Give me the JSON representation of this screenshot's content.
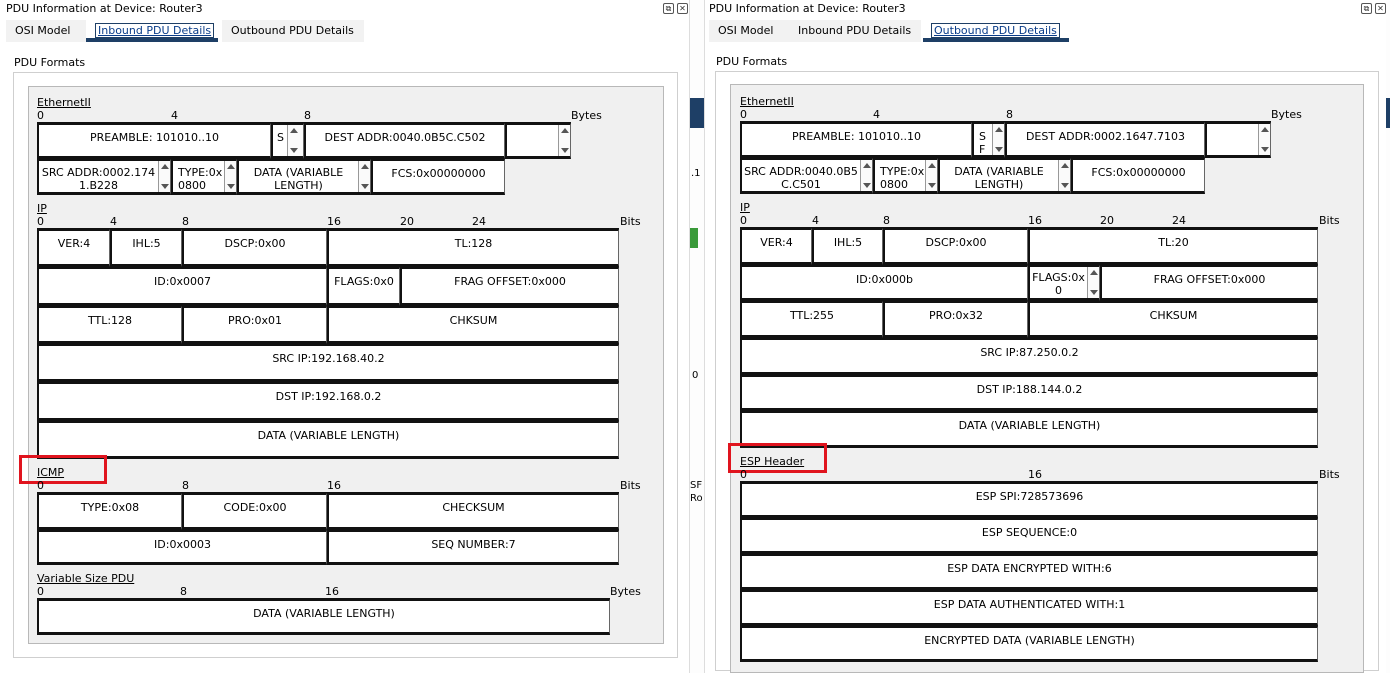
{
  "left": {
    "title": "PDU Information at Device: Router3",
    "tabs": [
      "OSI Model",
      "Inbound PDU Details",
      "Outbound PDU Details"
    ],
    "pdu_formats": "PDU Formats",
    "eth": {
      "name": "EthernetII",
      "ticks": [
        "0",
        "4",
        "8"
      ],
      "unit": "Bytes",
      "preamble": "PREAMBLE: 101010..10",
      "sfd": "S",
      "dest": "DEST ADDR:0040.0B5C.C502",
      "src": "SRC ADDR:0002.1741.B228",
      "type": "TYPE:0x0800",
      "data": "DATA (VARIABLE LENGTH)",
      "fcs": "FCS:0x00000000"
    },
    "ip": {
      "name": "IP",
      "ticks": [
        "0",
        "4",
        "8",
        "16",
        "20",
        "24"
      ],
      "unit": "Bits",
      "ver": "VER:4",
      "ihl": "IHL:5",
      "dscp": "DSCP:0x00",
      "tl": "TL:128",
      "id": "ID:0x0007",
      "flags": "FLAGS:0x0",
      "frag": "FRAG OFFSET:0x000",
      "ttl": "TTL:128",
      "pro": "PRO:0x01",
      "chksum": "CHKSUM",
      "src": "SRC IP:192.168.40.2",
      "dst": "DST IP:192.168.0.2",
      "data": "DATA (VARIABLE LENGTH)"
    },
    "icmp": {
      "name": "ICMP",
      "ticks": [
        "0",
        "8",
        "16"
      ],
      "unit": "Bits",
      "type": "TYPE:0x08",
      "code": "CODE:0x00",
      "checksum": "CHECKSUM",
      "id": "ID:0x0003",
      "seq": "SEQ NUMBER:7"
    },
    "var": {
      "name": "Variable Size PDU",
      "ticks": [
        "0",
        "8",
        "16"
      ],
      "unit": "Bytes",
      "data": "DATA (VARIABLE LENGTH)"
    }
  },
  "right": {
    "title": "PDU Information at Device: Router3",
    "tabs": [
      "OSI Model",
      "Inbound PDU Details",
      "Outbound PDU Details"
    ],
    "pdu_formats": "PDU Formats",
    "eth": {
      "name": "EthernetII",
      "ticks": [
        "0",
        "4",
        "8"
      ],
      "unit": "Bytes",
      "preamble": "PREAMBLE: 101010..10",
      "sfd": "SF",
      "dest": "DEST ADDR:0002.1647.7103",
      "src": "SRC ADDR:0040.0B5C.C501",
      "type": "TYPE:0x0800",
      "data": "DATA (VARIABLE LENGTH)",
      "fcs": "FCS:0x00000000"
    },
    "ip": {
      "name": "IP",
      "ticks": [
        "0",
        "4",
        "8",
        "16",
        "20",
        "24"
      ],
      "unit": "Bits",
      "ver": "VER:4",
      "ihl": "IHL:5",
      "dscp": "DSCP:0x00",
      "tl": "TL:20",
      "id": "ID:0x000b",
      "flags": "FLAGS:0x0",
      "frag": "FRAG OFFSET:0x000",
      "ttl": "TTL:255",
      "pro": "PRO:0x32",
      "chksum": "CHKSUM",
      "src": "SRC IP:87.250.0.2",
      "dst": "DST IP:188.144.0.2",
      "data": "DATA (VARIABLE LENGTH)"
    },
    "esp": {
      "name": "ESP Header",
      "ticks": [
        "0",
        "16"
      ],
      "unit": "Bits",
      "spi": "ESP SPI:728573696",
      "seq": "ESP SEQUENCE:0",
      "enc": "ESP DATA ENCRYPTED WITH:6",
      "auth": "ESP DATA AUTHENTICATED WITH:1",
      "data": "ENCRYPTED DATA (VARIABLE LENGTH)"
    }
  },
  "background_fragments": [
    ".1",
    "0",
    "SF",
    "Ro"
  ],
  "colors": {
    "highlight": "#e0141e",
    "selected_tab": "#1e3f66",
    "panel": "#f0f0f0"
  }
}
